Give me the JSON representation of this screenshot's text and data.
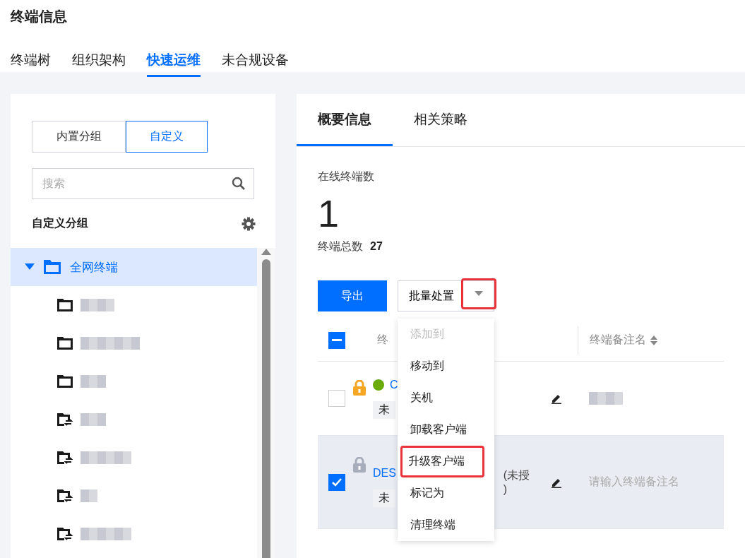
{
  "page_title": "终端信息",
  "tabs": [
    {
      "label": "终端树",
      "selected": false
    },
    {
      "label": "组织架构",
      "selected": false
    },
    {
      "label": "快速运维",
      "selected": true
    },
    {
      "label": "未合规设备",
      "selected": false
    }
  ],
  "sidebar": {
    "segments": [
      {
        "label": "内置分组",
        "selected": false
      },
      {
        "label": "自定义",
        "selected": true
      }
    ],
    "search": {
      "placeholder": "搜索"
    },
    "section_title": "自定义分组",
    "tree": [
      {
        "label": "全网终端",
        "expanded": true,
        "selected": true,
        "children": [
          {
            "kind": "folder"
          },
          {
            "kind": "folder"
          },
          {
            "kind": "folder"
          },
          {
            "kind": "shared-folder"
          },
          {
            "kind": "shared-folder"
          },
          {
            "kind": "shared-folder"
          },
          {
            "kind": "shared-folder"
          }
        ]
      }
    ]
  },
  "detail": {
    "tabs": [
      {
        "label": "概要信息",
        "selected": true
      },
      {
        "label": "相关策略",
        "selected": false
      }
    ],
    "online_label": "在线终端数",
    "online_count": "1",
    "total_label": "终端总数",
    "total_count": "27",
    "export_button": "导出",
    "batch": {
      "label": "批量处置",
      "caret_highlighted": true,
      "menu": [
        {
          "label": "添加到",
          "disabled": true,
          "highlighted": false
        },
        {
          "label": "移动到",
          "disabled": false,
          "highlighted": false
        },
        {
          "label": "关机",
          "disabled": false,
          "highlighted": false
        },
        {
          "label": "卸载客户端",
          "disabled": false,
          "highlighted": false
        },
        {
          "label": "升级客户端",
          "disabled": false,
          "highlighted": true
        },
        {
          "label": "标记为",
          "disabled": false,
          "highlighted": false
        },
        {
          "label": "清理终端",
          "disabled": false,
          "highlighted": false
        }
      ]
    },
    "table": {
      "header_partial": true,
      "columns": [
        "终",
        "终端备注名"
      ],
      "rows": [
        {
          "selected": false,
          "lock_active": true,
          "online": true,
          "name": "C",
          "auth": [],
          "tag": "未",
          "note_placeholder": null
        },
        {
          "selected": true,
          "lock_active": false,
          "online": false,
          "name": "DES",
          "auth": [
            "(未授",
            ")"
          ],
          "tag": "未",
          "note_placeholder": "请输入终端备注名"
        }
      ]
    }
  }
}
